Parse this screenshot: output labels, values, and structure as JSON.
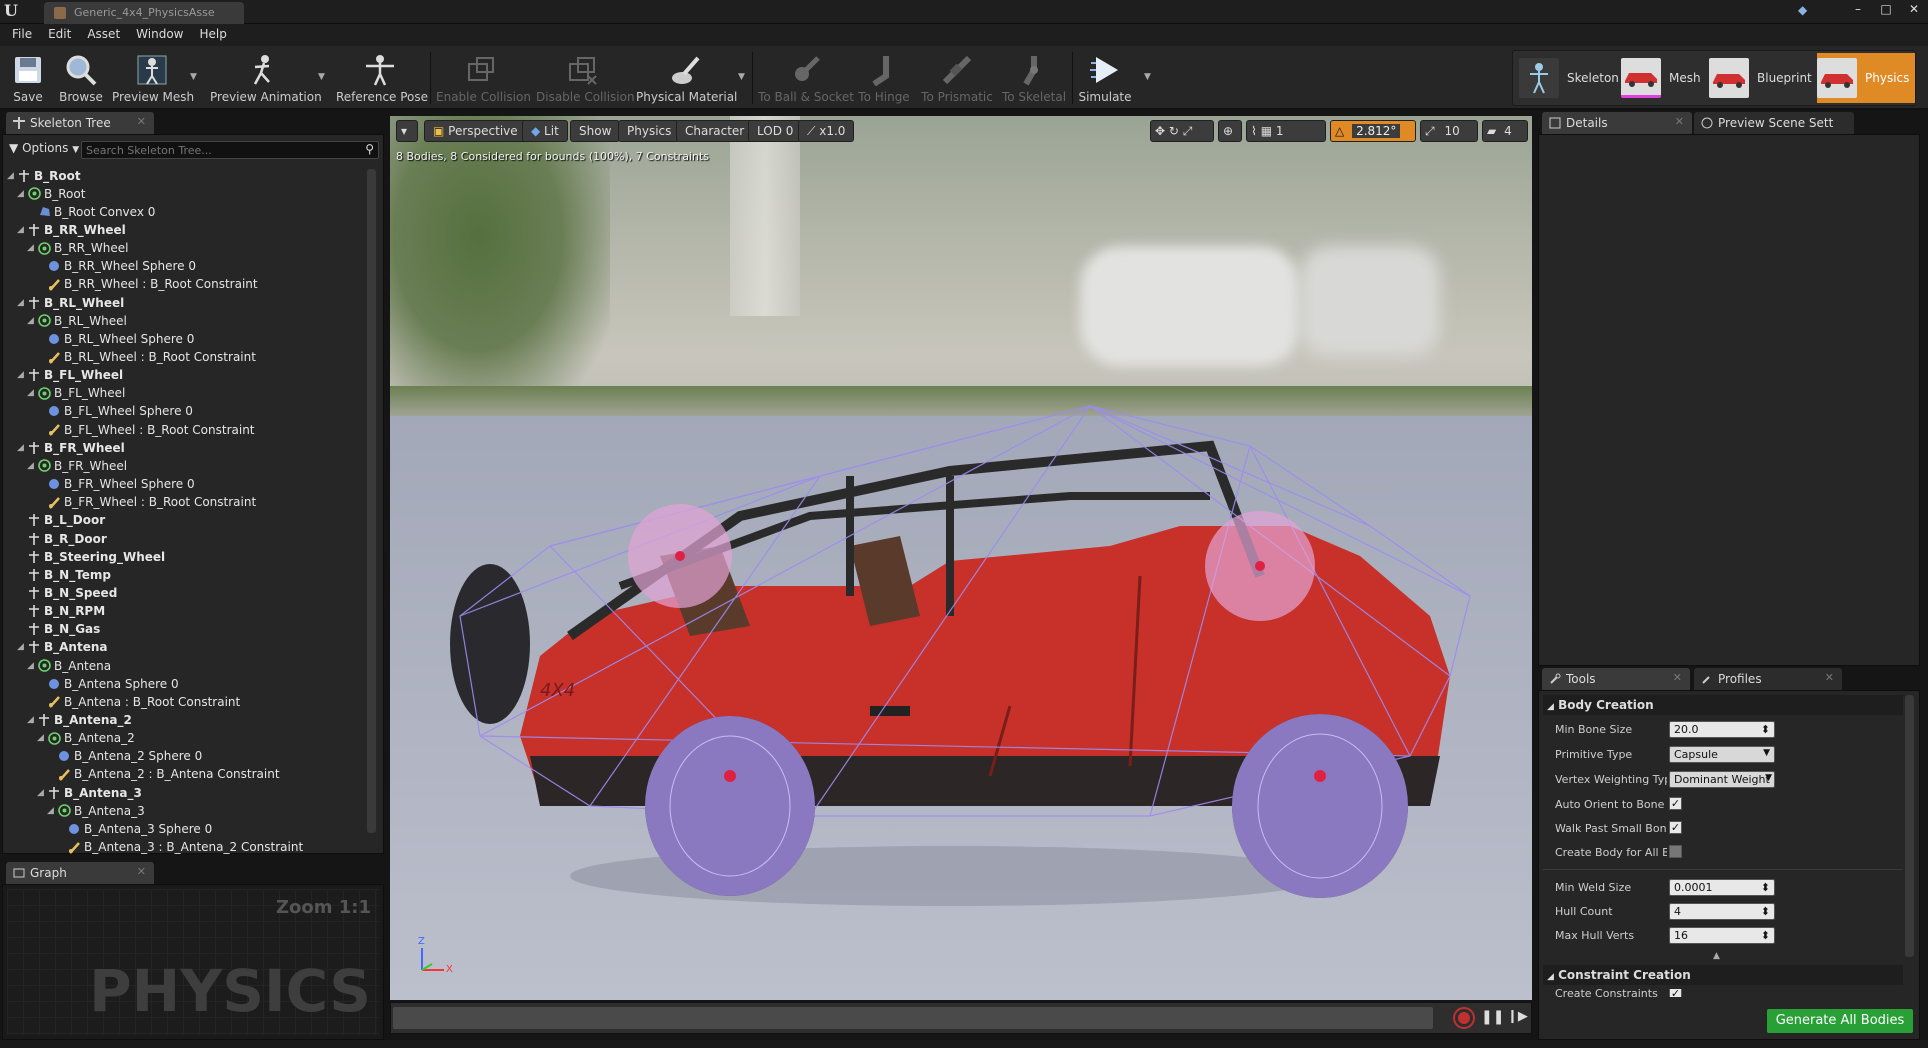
{
  "window": {
    "doc_tab": "Generic_4x4_PhysicsAsse",
    "minimize": "–",
    "maximize": "□",
    "close": "✕"
  },
  "menu": [
    "File",
    "Edit",
    "Asset",
    "Window",
    "Help"
  ],
  "toolbar": {
    "save": "Save",
    "browse": "Browse",
    "preview_mesh": "Preview Mesh",
    "preview_animation": "Preview Animation",
    "reference_pose": "Reference Pose",
    "enable_collision": "Enable Collision",
    "disable_collision": "Disable Collision",
    "physical_material": "Physical Material",
    "to_ball_socket": "To Ball & Socket",
    "to_hinge": "To Hinge",
    "to_prismatic": "To Prismatic",
    "to_skeletal": "To Skeletal",
    "simulate": "Simulate"
  },
  "modes": {
    "skeleton": "Skeleton",
    "mesh": "Mesh",
    "blueprint": "Blueprint",
    "physics": "Physics"
  },
  "skeleton_tree": {
    "tab": "Skeleton Tree",
    "options": "Options",
    "search_placeholder": "Search Skeleton Tree...",
    "rows": [
      {
        "label": "B_Root",
        "type": "bone",
        "indent": 0,
        "bold": true
      },
      {
        "label": "B_Root",
        "type": "body",
        "indent": 1,
        "bold": false
      },
      {
        "label": "B_Root Convex 0",
        "type": "convex",
        "indent": 2,
        "bold": false
      },
      {
        "label": "B_RR_Wheel",
        "type": "bone",
        "indent": 1,
        "bold": true
      },
      {
        "label": "B_RR_Wheel",
        "type": "body",
        "indent": 2,
        "bold": false
      },
      {
        "label": "B_RR_Wheel Sphere 0",
        "type": "sphere",
        "indent": 3,
        "bold": false
      },
      {
        "label": "B_RR_Wheel : B_Root Constraint",
        "type": "constraint",
        "indent": 3,
        "bold": false
      },
      {
        "label": "B_RL_Wheel",
        "type": "bone",
        "indent": 1,
        "bold": true
      },
      {
        "label": "B_RL_Wheel",
        "type": "body",
        "indent": 2,
        "bold": false
      },
      {
        "label": "B_RL_Wheel Sphere 0",
        "type": "sphere",
        "indent": 3,
        "bold": false
      },
      {
        "label": "B_RL_Wheel : B_Root Constraint",
        "type": "constraint",
        "indent": 3,
        "bold": false
      },
      {
        "label": "B_FL_Wheel",
        "type": "bone",
        "indent": 1,
        "bold": true
      },
      {
        "label": "B_FL_Wheel",
        "type": "body",
        "indent": 2,
        "bold": false
      },
      {
        "label": "B_FL_Wheel Sphere 0",
        "type": "sphere",
        "indent": 3,
        "bold": false
      },
      {
        "label": "B_FL_Wheel : B_Root Constraint",
        "type": "constraint",
        "indent": 3,
        "bold": false
      },
      {
        "label": "B_FR_Wheel",
        "type": "bone",
        "indent": 1,
        "bold": true
      },
      {
        "label": "B_FR_Wheel",
        "type": "body",
        "indent": 2,
        "bold": false
      },
      {
        "label": "B_FR_Wheel Sphere 0",
        "type": "sphere",
        "indent": 3,
        "bold": false
      },
      {
        "label": "B_FR_Wheel : B_Root Constraint",
        "type": "constraint",
        "indent": 3,
        "bold": false
      },
      {
        "label": "B_L_Door",
        "type": "bone",
        "indent": 1,
        "bold": true
      },
      {
        "label": "B_R_Door",
        "type": "bone",
        "indent": 1,
        "bold": true
      },
      {
        "label": "B_Steering_Wheel",
        "type": "bone",
        "indent": 1,
        "bold": true
      },
      {
        "label": "B_N_Temp",
        "type": "bone",
        "indent": 1,
        "bold": true
      },
      {
        "label": "B_N_Speed",
        "type": "bone",
        "indent": 1,
        "bold": true
      },
      {
        "label": "B_N_RPM",
        "type": "bone",
        "indent": 1,
        "bold": true
      },
      {
        "label": "B_N_Gas",
        "type": "bone",
        "indent": 1,
        "bold": true
      },
      {
        "label": "B_Antena",
        "type": "bone",
        "indent": 1,
        "bold": true
      },
      {
        "label": "B_Antena",
        "type": "body",
        "indent": 2,
        "bold": false
      },
      {
        "label": "B_Antena Sphere 0",
        "type": "sphere",
        "indent": 3,
        "bold": false
      },
      {
        "label": "B_Antena : B_Root Constraint",
        "type": "constraint",
        "indent": 3,
        "bold": false
      },
      {
        "label": "B_Antena_2",
        "type": "bone",
        "indent": 2,
        "bold": true
      },
      {
        "label": "B_Antena_2",
        "type": "body",
        "indent": 3,
        "bold": false
      },
      {
        "label": "B_Antena_2 Sphere 0",
        "type": "sphere",
        "indent": 4,
        "bold": false
      },
      {
        "label": "B_Antena_2 : B_Antena Constraint",
        "type": "constraint",
        "indent": 4,
        "bold": false
      },
      {
        "label": "B_Antena_3",
        "type": "bone",
        "indent": 3,
        "bold": true
      },
      {
        "label": "B_Antena_3",
        "type": "body",
        "indent": 4,
        "bold": false
      },
      {
        "label": "B_Antena_3 Sphere 0",
        "type": "sphere",
        "indent": 5,
        "bold": false
      },
      {
        "label": "B_Antena_3 : B_Antena_2 Constraint",
        "type": "constraint",
        "indent": 5,
        "bold": false
      }
    ]
  },
  "graph": {
    "tab": "Graph",
    "zoom": "Zoom 1:1",
    "watermark": "PHYSICS"
  },
  "viewport": {
    "perspective": "Perspective",
    "lit": "Lit",
    "show": "Show",
    "physics": "Physics",
    "character": "Character",
    "lod": "LOD 0",
    "speed": "x1.0",
    "stats": "8 Bodies, 8 Considered for bounds (100%), 7 Constraints",
    "angle": "2.812°",
    "grid": "10",
    "cam": "4",
    "snap": "1",
    "axis_z": "Z",
    "axis_x": "X",
    "decal": "4X4"
  },
  "details": {
    "tab": "Details",
    "preview_tab": "Preview Scene Sett"
  },
  "tools": {
    "tab": "Tools",
    "profiles_tab": "Profiles",
    "body_creation": "Body Creation",
    "min_bone_size_label": "Min Bone Size",
    "min_bone_size": "20.0",
    "primitive_type_label": "Primitive Type",
    "primitive_type": "Capsule",
    "vertex_weighting_label": "Vertex Weighting Type",
    "vertex_weighting": "Dominant Weight",
    "auto_orient_label": "Auto Orient to Bone",
    "auto_orient": true,
    "walk_past_label": "Walk Past Small Bones",
    "walk_past": true,
    "create_body_label": "Create Body for All Bones",
    "create_body": false,
    "min_weld_label": "Min Weld Size",
    "min_weld": "0.0001",
    "hull_count_label": "Hull Count",
    "hull_count": "4",
    "max_hull_label": "Max Hull Verts",
    "max_hull": "16",
    "constraint_creation": "Constraint Creation",
    "create_constraints_label": "Create Constraints",
    "generate": "Generate All Bodies"
  },
  "colors": {
    "accent": "#e08a26",
    "generate_green": "#28a035",
    "body_purple": "#a88cf0"
  }
}
